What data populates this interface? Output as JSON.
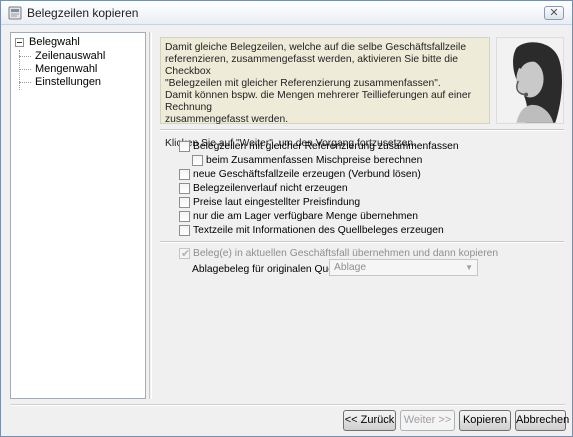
{
  "window": {
    "title": "Belegzeilen kopieren",
    "close_label": "✕"
  },
  "tree": {
    "root": "Belegwahl",
    "items": [
      {
        "label": "Zeilenauswahl"
      },
      {
        "label": "Mengenwahl"
      },
      {
        "label": "Einstellungen"
      }
    ]
  },
  "info": {
    "line1": "Damit gleiche Belegzeilen, welche auf die selbe Geschäftsfallzeile",
    "line2": "referenzieren, zusammengefasst werden, aktivieren Sie bitte die Checkbox",
    "line3": "\"Belegzeilen mit gleicher Referenzierung zusammenfassen\".",
    "line4": "Damit können bspw. die Mengen mehrerer Teillieferungen auf einer Rechnung",
    "line5": "zusammengefasst werden.",
    "line6": "Klicken Sie auf \"Weiter\", um den Vorgang fortzusetzen."
  },
  "options": [
    {
      "label": "Belegzeilen mit gleicher Referenzierung zusammenfassen",
      "checked": false
    },
    {
      "label": "beim Zusammenfassen Mischpreise berechnen",
      "checked": false
    },
    {
      "label": "neue Geschäftsfallzeile erzeugen (Verbund lösen)",
      "checked": false
    },
    {
      "label": "Belegzeilenverlauf nicht erzeugen",
      "checked": false
    },
    {
      "label": "Preise laut eingestellter Preisfindung",
      "checked": false
    },
    {
      "label": "nur die am Lager verfügbare Menge übernehmen",
      "checked": false
    },
    {
      "label": "Textzeile mit Informationen des Quellbeleges erzeugen",
      "checked": false
    }
  ],
  "transfer": {
    "label": "Beleg(e) in aktuellen Geschäftsfall übernehmen und dann kopieren",
    "checked": true,
    "disabled": true
  },
  "archive": {
    "label": "Ablagebeleg für originalen Quellbeleg",
    "value": "Ablage"
  },
  "buttons": {
    "back": "<< Zurück",
    "next": "Weiter >>",
    "copy": "Kopieren",
    "cancel": "Abbrechen"
  },
  "colors": {
    "info_bg": "#eeebd9",
    "window_bg": "#f0f0f0"
  }
}
